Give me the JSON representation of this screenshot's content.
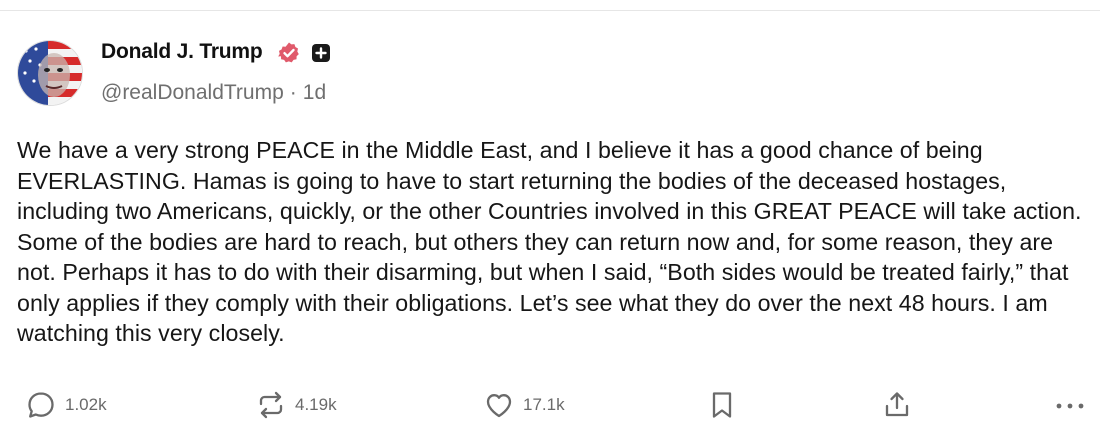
{
  "author": {
    "name": "Donald J. Trump",
    "handle": "@realDonaldTrump",
    "separator": "·",
    "time": "1d"
  },
  "post": {
    "text": "We have a very strong PEACE in the Middle East, and I believe it has a good chance of being EVERLASTING. Hamas is going to have to start returning the bodies of the deceased hostages, including two Americans, quickly, or the other Countries involved in this GREAT PEACE will take action. Some of the bodies are hard to reach, but others they can return now and, for some reason, they are not. Perhaps it has to do with their disarming, but when I said, “Both sides would be treated fairly,” that only applies if they comply with their obligations. Let’s see what they do over the next 48 hours. I am watching this very closely."
  },
  "actions": {
    "replies": "1.02k",
    "reposts": "4.19k",
    "likes": "17.1k"
  },
  "colors": {
    "verified": "#e05a6b",
    "muted_text": "#6f6f6f",
    "icon": "#6a6a6a"
  },
  "icons": [
    "verified-icon",
    "plus-badge-icon",
    "reply-icon",
    "repost-icon",
    "heart-icon",
    "bookmark-icon",
    "share-icon",
    "more-icon"
  ]
}
